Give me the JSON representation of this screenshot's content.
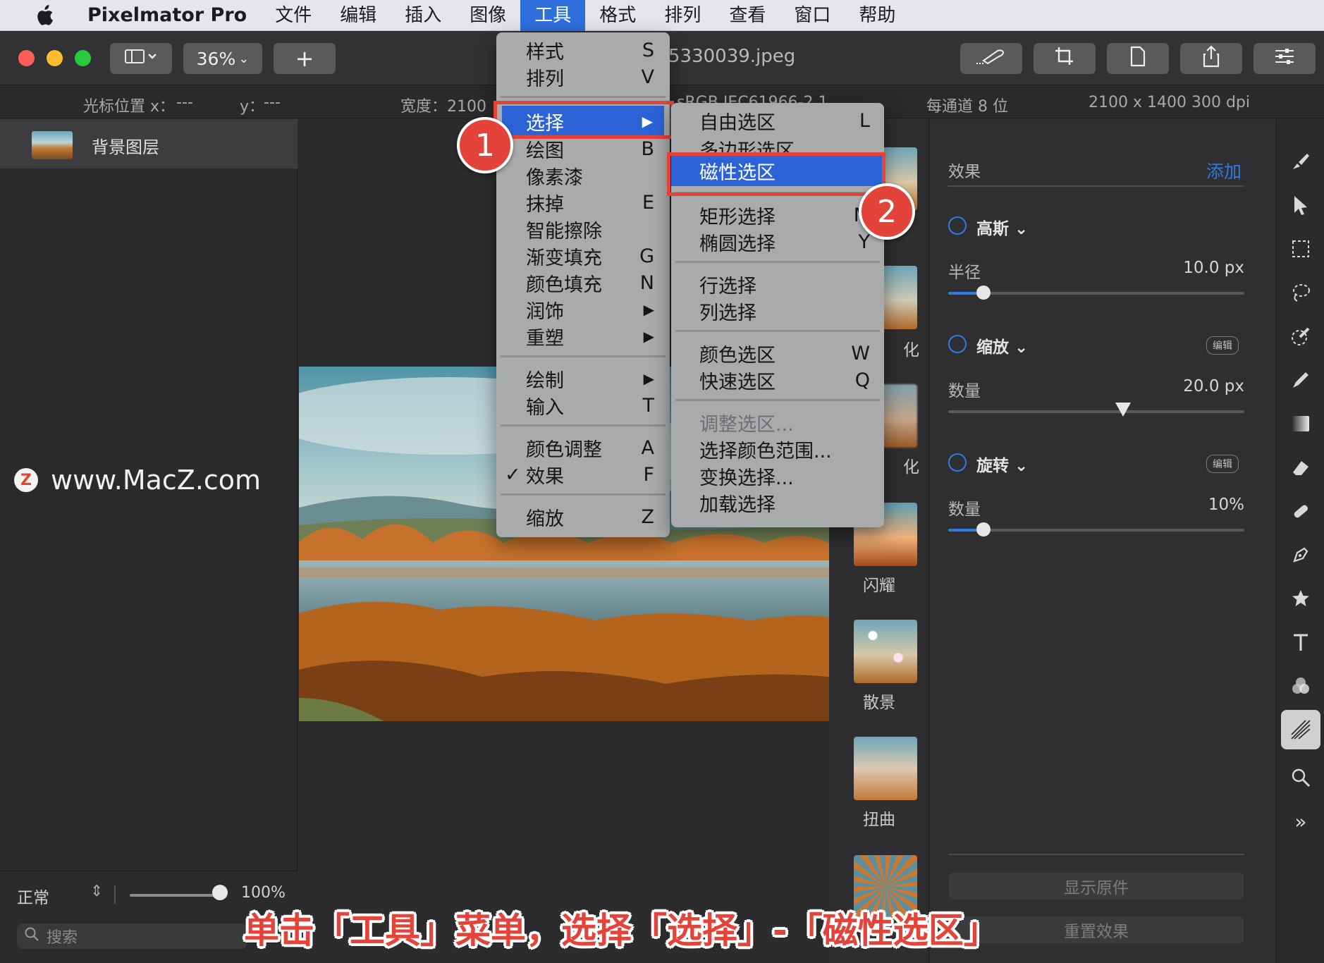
{
  "menubar": {
    "app": "Pixelmator Pro",
    "items": [
      "文件",
      "编辑",
      "插入",
      "图像",
      "工具",
      "格式",
      "排列",
      "查看",
      "窗口",
      "帮助"
    ],
    "active": "工具"
  },
  "toolbar": {
    "zoom": "36%",
    "add_label": "+",
    "doc_title": "5330039.jpeg"
  },
  "infobar": {
    "cursor_x_label": "光标位置 x：",
    "cursor_x_value": "---",
    "cursor_y_label": "y：",
    "cursor_y_value": "---",
    "width": "宽度：2100",
    "profile": "sRGB IEC61966-2.1",
    "depth": "每通道 8 位",
    "size": "2100 x 1400 300 dpi"
  },
  "layers": {
    "layer_name": "背景图层",
    "blend_mode": "正常",
    "opacity": "100%",
    "opacity_fraction": 1.0,
    "search_placeholder": "搜索"
  },
  "watermark": {
    "icon_letter": "Z",
    "text": "www.MacZ.com"
  },
  "tools_menu": {
    "items": [
      {
        "label": "样式",
        "shortcut": "S"
      },
      {
        "label": "排列",
        "shortcut": "V"
      },
      {
        "label": "选择",
        "shortcut": "▶"
      },
      {
        "label": "绘图",
        "shortcut": "B"
      },
      {
        "label": "像素漆",
        "shortcut": ""
      },
      {
        "label": "抹掉",
        "shortcut": "E"
      },
      {
        "label": "智能擦除",
        "shortcut": ""
      },
      {
        "label": "渐变填充",
        "shortcut": "G"
      },
      {
        "label": "颜色填充",
        "shortcut": "N"
      },
      {
        "label": "润饰",
        "shortcut": "▶"
      },
      {
        "label": "重塑",
        "shortcut": "▶"
      },
      {
        "label": "绘制",
        "shortcut": "▶"
      },
      {
        "label": "输入",
        "shortcut": "T"
      },
      {
        "label": "颜色调整",
        "shortcut": "A"
      },
      {
        "label": "效果",
        "shortcut": "F"
      },
      {
        "label": "缩放",
        "shortcut": "Z"
      }
    ],
    "checkmark": "✓"
  },
  "select_submenu": {
    "items": [
      {
        "label": "自由选区",
        "shortcut": "L"
      },
      {
        "label": "多边形选区",
        "shortcut": ""
      },
      {
        "label": "磁性选区",
        "shortcut": ""
      },
      {
        "label": "矩形选择",
        "shortcut": "M"
      },
      {
        "label": "椭圆选择",
        "shortcut": "Y"
      },
      {
        "label": "行选择",
        "shortcut": ""
      },
      {
        "label": "列选择",
        "shortcut": ""
      },
      {
        "label": "颜色选区",
        "shortcut": "W"
      },
      {
        "label": "快速选区",
        "shortcut": "Q"
      },
      {
        "label": "调整选区...",
        "shortcut": ""
      },
      {
        "label": "选择颜色范围...",
        "shortcut": ""
      },
      {
        "label": "变换选择...",
        "shortcut": ""
      },
      {
        "label": "加载选择",
        "shortcut": ""
      }
    ]
  },
  "callouts": [
    "1",
    "2"
  ],
  "effects_browser": {
    "labels": [
      "化",
      "化",
      "闪耀",
      "散景",
      "扭曲"
    ]
  },
  "inspector": {
    "title": "效果",
    "add": "添加",
    "sections": [
      {
        "name": "高斯 ⌄",
        "param": "半径",
        "value": "10.0 px",
        "fraction": 0.12,
        "badge": ""
      },
      {
        "name": "缩放 ⌄",
        "param": "数量",
        "value": "20.0 px",
        "fraction": 0.59,
        "badge": "编辑"
      },
      {
        "name": "旋转 ⌄",
        "param": "数量",
        "value": "10%",
        "fraction": 0.12,
        "badge": "编辑"
      }
    ],
    "show_original": "显示原件",
    "reset_effects": "重置效果"
  },
  "tools": [
    "brush-icon",
    "arrange-icon",
    "rect-select-icon",
    "lasso-icon",
    "paint-icon",
    "pencil-icon",
    "gradient-icon",
    "erase-icon",
    "repair-icon",
    "pen-icon",
    "shape-icon",
    "type-icon",
    "color-adjust-icon",
    "effects-icon",
    "zoom-icon",
    "more-icon"
  ],
  "caption": "单击「工具」菜单，选择「选择」-「磁性选区」",
  "colors": {
    "accent": "#2f7ae5",
    "highlight": "#2b63d6",
    "callout": "#e4433a"
  }
}
